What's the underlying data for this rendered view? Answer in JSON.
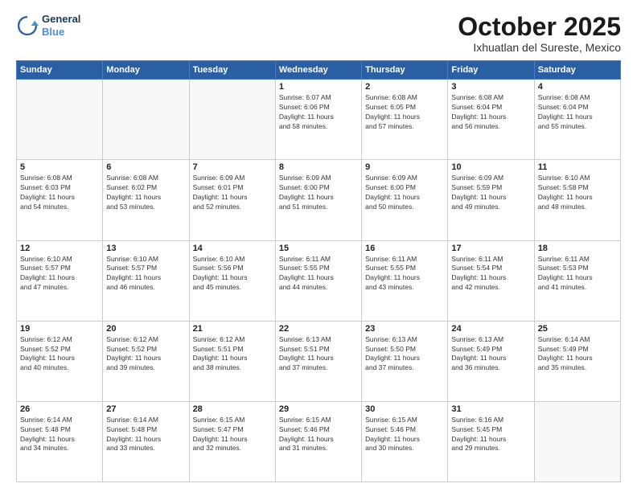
{
  "logo": {
    "line1": "General",
    "line2": "Blue"
  },
  "title": "October 2025",
  "location": "Ixhuatlan del Sureste, Mexico",
  "weekdays": [
    "Sunday",
    "Monday",
    "Tuesday",
    "Wednesday",
    "Thursday",
    "Friday",
    "Saturday"
  ],
  "weeks": [
    [
      {
        "day": "",
        "info": ""
      },
      {
        "day": "",
        "info": ""
      },
      {
        "day": "",
        "info": ""
      },
      {
        "day": "1",
        "info": "Sunrise: 6:07 AM\nSunset: 6:06 PM\nDaylight: 11 hours\nand 58 minutes."
      },
      {
        "day": "2",
        "info": "Sunrise: 6:08 AM\nSunset: 6:05 PM\nDaylight: 11 hours\nand 57 minutes."
      },
      {
        "day": "3",
        "info": "Sunrise: 6:08 AM\nSunset: 6:04 PM\nDaylight: 11 hours\nand 56 minutes."
      },
      {
        "day": "4",
        "info": "Sunrise: 6:08 AM\nSunset: 6:04 PM\nDaylight: 11 hours\nand 55 minutes."
      }
    ],
    [
      {
        "day": "5",
        "info": "Sunrise: 6:08 AM\nSunset: 6:03 PM\nDaylight: 11 hours\nand 54 minutes."
      },
      {
        "day": "6",
        "info": "Sunrise: 6:08 AM\nSunset: 6:02 PM\nDaylight: 11 hours\nand 53 minutes."
      },
      {
        "day": "7",
        "info": "Sunrise: 6:09 AM\nSunset: 6:01 PM\nDaylight: 11 hours\nand 52 minutes."
      },
      {
        "day": "8",
        "info": "Sunrise: 6:09 AM\nSunset: 6:00 PM\nDaylight: 11 hours\nand 51 minutes."
      },
      {
        "day": "9",
        "info": "Sunrise: 6:09 AM\nSunset: 6:00 PM\nDaylight: 11 hours\nand 50 minutes."
      },
      {
        "day": "10",
        "info": "Sunrise: 6:09 AM\nSunset: 5:59 PM\nDaylight: 11 hours\nand 49 minutes."
      },
      {
        "day": "11",
        "info": "Sunrise: 6:10 AM\nSunset: 5:58 PM\nDaylight: 11 hours\nand 48 minutes."
      }
    ],
    [
      {
        "day": "12",
        "info": "Sunrise: 6:10 AM\nSunset: 5:57 PM\nDaylight: 11 hours\nand 47 minutes."
      },
      {
        "day": "13",
        "info": "Sunrise: 6:10 AM\nSunset: 5:57 PM\nDaylight: 11 hours\nand 46 minutes."
      },
      {
        "day": "14",
        "info": "Sunrise: 6:10 AM\nSunset: 5:56 PM\nDaylight: 11 hours\nand 45 minutes."
      },
      {
        "day": "15",
        "info": "Sunrise: 6:11 AM\nSunset: 5:55 PM\nDaylight: 11 hours\nand 44 minutes."
      },
      {
        "day": "16",
        "info": "Sunrise: 6:11 AM\nSunset: 5:55 PM\nDaylight: 11 hours\nand 43 minutes."
      },
      {
        "day": "17",
        "info": "Sunrise: 6:11 AM\nSunset: 5:54 PM\nDaylight: 11 hours\nand 42 minutes."
      },
      {
        "day": "18",
        "info": "Sunrise: 6:11 AM\nSunset: 5:53 PM\nDaylight: 11 hours\nand 41 minutes."
      }
    ],
    [
      {
        "day": "19",
        "info": "Sunrise: 6:12 AM\nSunset: 5:52 PM\nDaylight: 11 hours\nand 40 minutes."
      },
      {
        "day": "20",
        "info": "Sunrise: 6:12 AM\nSunset: 5:52 PM\nDaylight: 11 hours\nand 39 minutes."
      },
      {
        "day": "21",
        "info": "Sunrise: 6:12 AM\nSunset: 5:51 PM\nDaylight: 11 hours\nand 38 minutes."
      },
      {
        "day": "22",
        "info": "Sunrise: 6:13 AM\nSunset: 5:51 PM\nDaylight: 11 hours\nand 37 minutes."
      },
      {
        "day": "23",
        "info": "Sunrise: 6:13 AM\nSunset: 5:50 PM\nDaylight: 11 hours\nand 37 minutes."
      },
      {
        "day": "24",
        "info": "Sunrise: 6:13 AM\nSunset: 5:49 PM\nDaylight: 11 hours\nand 36 minutes."
      },
      {
        "day": "25",
        "info": "Sunrise: 6:14 AM\nSunset: 5:49 PM\nDaylight: 11 hours\nand 35 minutes."
      }
    ],
    [
      {
        "day": "26",
        "info": "Sunrise: 6:14 AM\nSunset: 5:48 PM\nDaylight: 11 hours\nand 34 minutes."
      },
      {
        "day": "27",
        "info": "Sunrise: 6:14 AM\nSunset: 5:48 PM\nDaylight: 11 hours\nand 33 minutes."
      },
      {
        "day": "28",
        "info": "Sunrise: 6:15 AM\nSunset: 5:47 PM\nDaylight: 11 hours\nand 32 minutes."
      },
      {
        "day": "29",
        "info": "Sunrise: 6:15 AM\nSunset: 5:46 PM\nDaylight: 11 hours\nand 31 minutes."
      },
      {
        "day": "30",
        "info": "Sunrise: 6:15 AM\nSunset: 5:46 PM\nDaylight: 11 hours\nand 30 minutes."
      },
      {
        "day": "31",
        "info": "Sunrise: 6:16 AM\nSunset: 5:45 PM\nDaylight: 11 hours\nand 29 minutes."
      },
      {
        "day": "",
        "info": ""
      }
    ]
  ]
}
